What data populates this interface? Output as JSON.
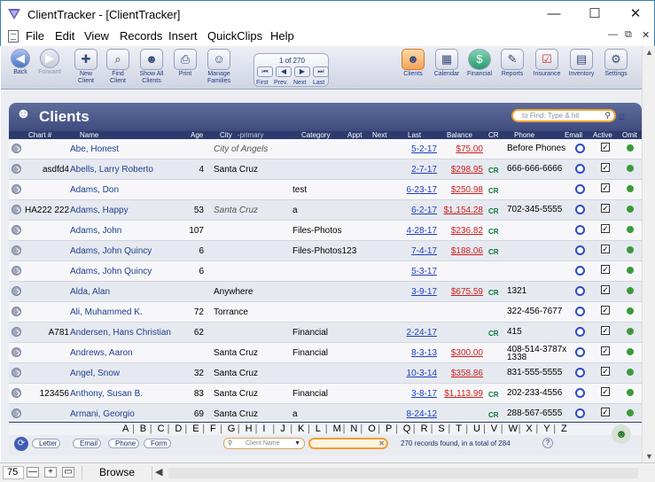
{
  "window": {
    "title": "ClientTracker - [ClientTracker]",
    "minimize": "—",
    "maximize": "☐",
    "close": "✕"
  },
  "menu": {
    "items": [
      "File",
      "Edit",
      "View",
      "Records",
      "Insert",
      "QuickClips",
      "Help"
    ],
    "doc_min": "—",
    "doc_restore": "⧉",
    "doc_close": "✕"
  },
  "toolbar": {
    "back": "Back",
    "forward": "Forward",
    "new_client": "New Client",
    "find_client": "Find Client",
    "show_all": "Show All Clients",
    "print": "Print",
    "manage_families": "Manage Families",
    "record_count": "1 of 270",
    "first": "First",
    "prev": "Prev.",
    "next": "Next",
    "last": "Last",
    "clients": "Clients",
    "calendar": "Calendar",
    "financial": "Financial",
    "reports": "Reports",
    "insurance": "Insurance",
    "inventory": "Inventory",
    "settings": "Settings"
  },
  "header": {
    "title": "Clients",
    "find_placeholder": "to Find: Type & hit",
    "find_clear": "cr"
  },
  "columns": {
    "chart": "Chart #",
    "name": "Name",
    "age": "Age",
    "city": "City",
    "city_sub": "-primary",
    "category": "Category",
    "appt": "Appt",
    "next": "Next",
    "last": "Last",
    "balance": "Balance",
    "cr": "CR",
    "phone": "Phone",
    "email": "Email",
    "active": "Active",
    "omit": "Omit"
  },
  "rows": [
    {
      "chart": "",
      "name": "Abe, Honest",
      "age": "",
      "city": "City of Angels",
      "city_italic": true,
      "category": "",
      "last": "5-2-17",
      "balance": "$75.00",
      "cr": "",
      "phone": "Before Phones"
    },
    {
      "chart": "asdfd4",
      "name": "Abells, Larry Roberto",
      "age": "4",
      "city": "Santa Cruz",
      "city_italic": false,
      "category": "",
      "last": "2-7-17",
      "balance": "$298.95",
      "cr": "CR",
      "phone": "666-666-6666"
    },
    {
      "chart": "",
      "name": "Adams, Don",
      "age": "",
      "city": "",
      "city_italic": false,
      "category": "test",
      "last": "6-23-17",
      "balance": "$250.98",
      "cr": "CR",
      "phone": ""
    },
    {
      "chart": "HA222 222",
      "name": "Adams, Happy",
      "age": "53",
      "city": "Santa Cruz",
      "city_italic": true,
      "category": "a",
      "last": "6-2-17",
      "balance": "$1,154.28",
      "cr": "CR",
      "phone": "702-345-5555"
    },
    {
      "chart": "",
      "name": "Adams, John",
      "age": "107",
      "city": "",
      "city_italic": false,
      "category": "Files-Photos",
      "last": "4-28-17",
      "balance": "$236.82",
      "cr": "CR",
      "phone": ""
    },
    {
      "chart": "",
      "name": "Adams, John Quincy",
      "age": "6",
      "city": "",
      "city_italic": false,
      "category": "Files-Photos123",
      "last": "7-4-17",
      "balance": "$188.06",
      "cr": "CR",
      "phone": ""
    },
    {
      "chart": "",
      "name": "Adams, John Quincy",
      "age": "6",
      "city": "",
      "city_italic": false,
      "category": "",
      "last": "5-3-17",
      "balance": "",
      "cr": "",
      "phone": ""
    },
    {
      "chart": "",
      "name": "Alda, Alan",
      "age": "",
      "city": "Anywhere",
      "city_italic": false,
      "category": "",
      "last": "3-9-17",
      "balance": "$675.59",
      "cr": "CR",
      "phone": "1321"
    },
    {
      "chart": "",
      "name": "Ali, Muhammed K.",
      "age": "72",
      "city": "Torrance",
      "city_italic": false,
      "category": "",
      "last": "",
      "balance": "",
      "cr": "",
      "phone": "322-456-7677"
    },
    {
      "chart": "A781",
      "name": "Andersen, Hans Christian",
      "age": "62",
      "city": "",
      "city_italic": false,
      "category": "Financial",
      "last": "2-24-17",
      "balance": "",
      "cr": "CR",
      "phone": "415"
    },
    {
      "chart": "",
      "name": "Andrews, Aaron",
      "age": "",
      "city": "Santa Cruz",
      "city_italic": false,
      "category": "Financial",
      "last": "8-3-13",
      "balance": "$300.00",
      "cr": "",
      "phone": "408-514-3787x 1338"
    },
    {
      "chart": "",
      "name": "Angel, Snow",
      "age": "32",
      "city": "Santa Cruz",
      "city_italic": false,
      "category": "",
      "last": "10-3-14",
      "balance": "$358.86",
      "cr": "",
      "phone": "831-555-5555"
    },
    {
      "chart": "123456",
      "name": "Anthony, Susan B.",
      "age": "83",
      "city": "Santa Cruz",
      "city_italic": false,
      "category": "Financial",
      "last": "3-8-17",
      "balance": "$1,113.99",
      "cr": "CR",
      "phone": "202-233-4556"
    },
    {
      "chart": "",
      "name": "Armani, Georgio",
      "age": "69",
      "city": "Santa Cruz",
      "city_italic": false,
      "category": "a",
      "last": "8-24-12",
      "balance": "",
      "cr": "CR",
      "phone": "288-567-6555"
    }
  ],
  "alphabet": [
    "A",
    "B",
    "C",
    "D",
    "E",
    "F",
    "G",
    "H",
    "I",
    "J",
    "K",
    "L",
    "M",
    "N",
    "O",
    "P",
    "Q",
    "R",
    "S",
    "T",
    "U",
    "V",
    "W",
    "X",
    "Y",
    "Z"
  ],
  "footer": {
    "letter": "Letter",
    "email": "Email",
    "phone": "Phone",
    "form": "Form",
    "search_field": "Client Name",
    "found_text": "270 records found, in a total of 284",
    "help": "?"
  },
  "status": {
    "zoom": "75",
    "mode": "Browse"
  }
}
